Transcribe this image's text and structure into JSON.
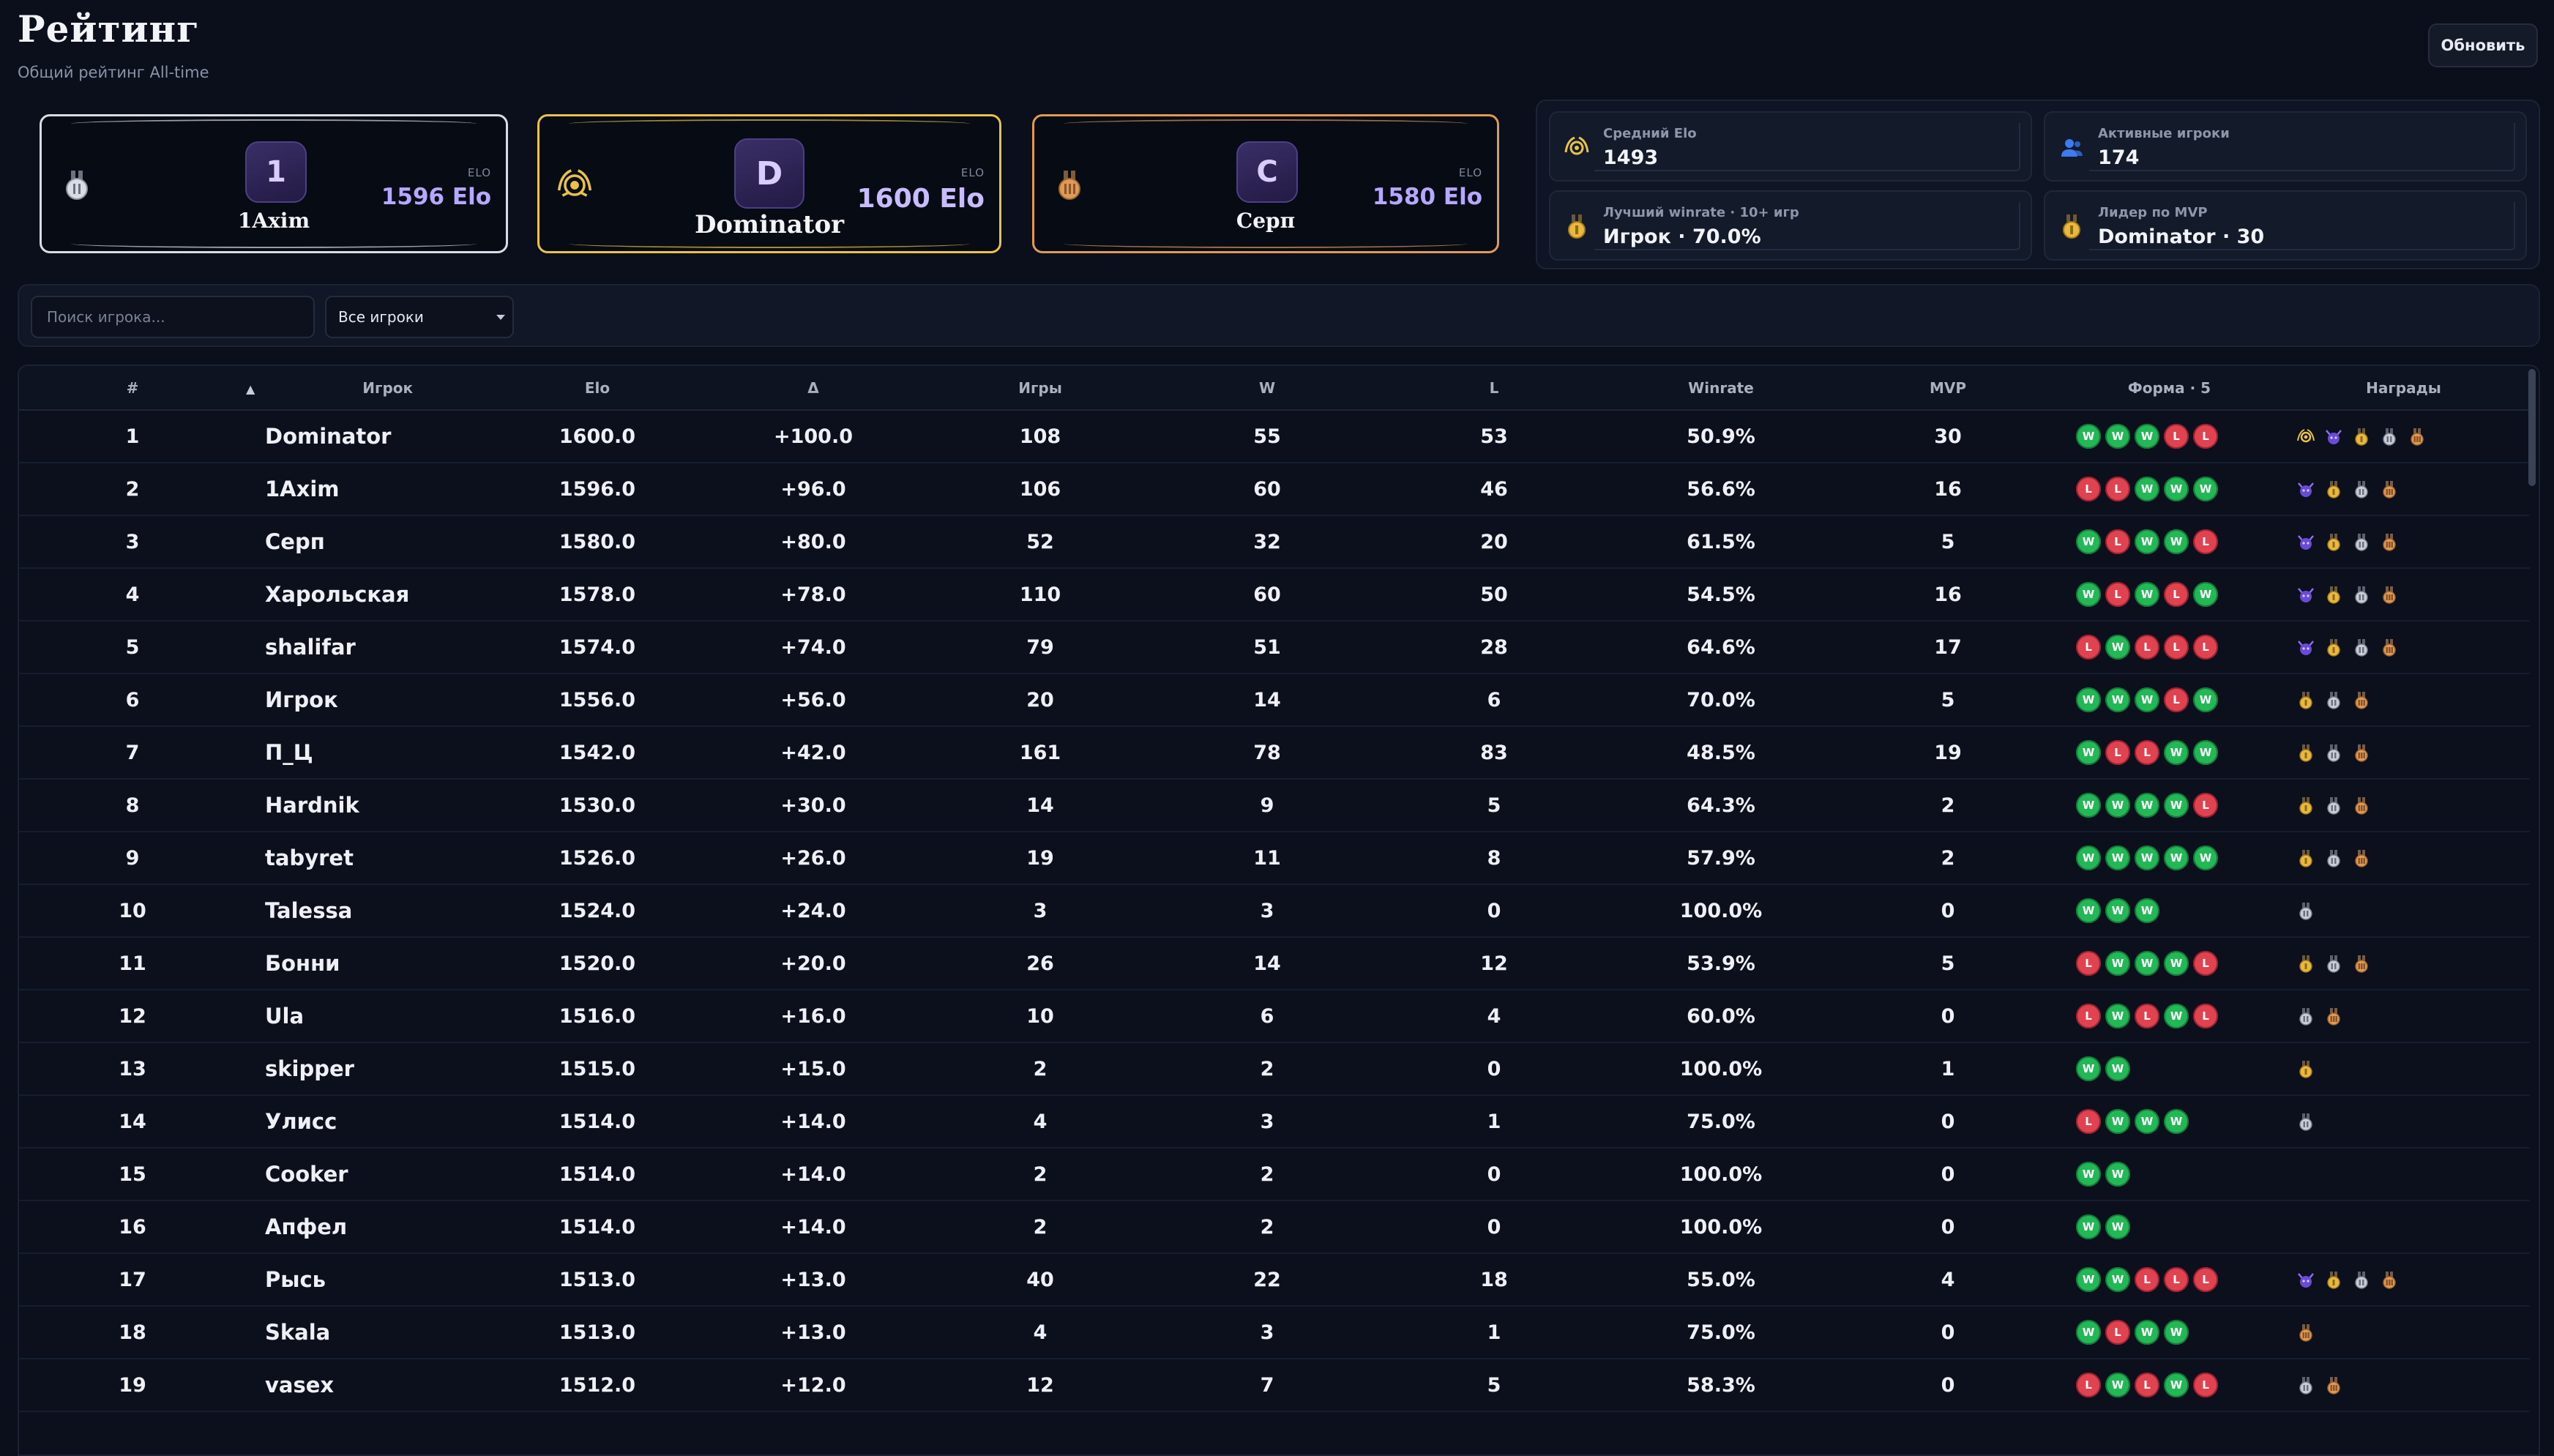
{
  "header": {
    "title": "Рейтинг",
    "subtitle": "Общий рейтинг All-time",
    "refresh_label": "Обновить"
  },
  "podium": [
    {
      "place": 2,
      "initial": "1",
      "name": "1Axim",
      "elo_label": "ELO",
      "elo": "1596 Elo",
      "color": "#d9dce3",
      "medal": "silver-medal-icon"
    },
    {
      "place": 1,
      "initial": "D",
      "name": "Dominator",
      "elo_label": "ELO",
      "elo": "1600 Elo",
      "color": "#e9c24a",
      "medal": "gold-laurel-icon"
    },
    {
      "place": 3,
      "initial": "С",
      "name": "Серп",
      "elo_label": "ELO",
      "elo": "1580 Elo",
      "color": "#e09a55",
      "medal": "bronze-medal-icon"
    }
  ],
  "stats": [
    {
      "label": "Средний Elo",
      "value": "1493",
      "icon": "laurel-icon"
    },
    {
      "label": "Активные игроки",
      "value": "174",
      "icon": "users-icon"
    },
    {
      "label": "Лучший winrate · 10+ игр",
      "value": "Игрок · 70.0%",
      "icon": "medal-icon"
    },
    {
      "label": "Лидер по MVP",
      "value": "Dominator · 30",
      "icon": "medal-icon"
    }
  ],
  "filters": {
    "search_placeholder": "Поиск игрока...",
    "players_select": "Все игроки"
  },
  "table": {
    "columns": [
      "#",
      "Игрок",
      "Elo",
      "Δ",
      "Игры",
      "W",
      "L",
      "Winrate",
      "MVP",
      "Форма · 5",
      "Награды"
    ],
    "rows": [
      {
        "rank": "1",
        "player": "Dominator",
        "elo": "1600.0",
        "delta": "+100.0",
        "games": "108",
        "w": "55",
        "l": "53",
        "winrate": "50.9%",
        "mvp": "30",
        "form": [
          "W",
          "W",
          "W",
          "L",
          "L"
        ],
        "awards": [
          "laurel",
          "demon",
          "gold",
          "silver",
          "bronze"
        ]
      },
      {
        "rank": "2",
        "player": "1Axim",
        "elo": "1596.0",
        "delta": "+96.0",
        "games": "106",
        "w": "60",
        "l": "46",
        "winrate": "56.6%",
        "mvp": "16",
        "form": [
          "L",
          "L",
          "W",
          "W",
          "W"
        ],
        "awards": [
          "demon",
          "gold",
          "silver",
          "bronze"
        ]
      },
      {
        "rank": "3",
        "player": "Серп",
        "elo": "1580.0",
        "delta": "+80.0",
        "games": "52",
        "w": "32",
        "l": "20",
        "winrate": "61.5%",
        "mvp": "5",
        "form": [
          "W",
          "L",
          "W",
          "W",
          "L"
        ],
        "awards": [
          "demon",
          "gold",
          "silver",
          "bronze"
        ]
      },
      {
        "rank": "4",
        "player": "Харольская",
        "elo": "1578.0",
        "delta": "+78.0",
        "games": "110",
        "w": "60",
        "l": "50",
        "winrate": "54.5%",
        "mvp": "16",
        "form": [
          "W",
          "L",
          "W",
          "L",
          "W"
        ],
        "awards": [
          "demon",
          "gold",
          "silver",
          "bronze"
        ]
      },
      {
        "rank": "5",
        "player": "shalifar",
        "elo": "1574.0",
        "delta": "+74.0",
        "games": "79",
        "w": "51",
        "l": "28",
        "winrate": "64.6%",
        "mvp": "17",
        "form": [
          "L",
          "W",
          "L",
          "L",
          "L"
        ],
        "awards": [
          "demon",
          "gold",
          "silver",
          "bronze"
        ]
      },
      {
        "rank": "6",
        "player": "Игрок",
        "elo": "1556.0",
        "delta": "+56.0",
        "games": "20",
        "w": "14",
        "l": "6",
        "winrate": "70.0%",
        "mvp": "5",
        "form": [
          "W",
          "W",
          "W",
          "L",
          "W"
        ],
        "awards": [
          "gold",
          "silver",
          "bronze"
        ]
      },
      {
        "rank": "7",
        "player": "П_Ц",
        "elo": "1542.0",
        "delta": "+42.0",
        "games": "161",
        "w": "78",
        "l": "83",
        "winrate": "48.5%",
        "mvp": "19",
        "form": [
          "W",
          "L",
          "L",
          "W",
          "W"
        ],
        "awards": [
          "gold",
          "silver",
          "bronze"
        ]
      },
      {
        "rank": "8",
        "player": "Hardnik",
        "elo": "1530.0",
        "delta": "+30.0",
        "games": "14",
        "w": "9",
        "l": "5",
        "winrate": "64.3%",
        "mvp": "2",
        "form": [
          "W",
          "W",
          "W",
          "W",
          "L"
        ],
        "awards": [
          "gold",
          "silver",
          "bronze"
        ]
      },
      {
        "rank": "9",
        "player": "tabyret",
        "elo": "1526.0",
        "delta": "+26.0",
        "games": "19",
        "w": "11",
        "l": "8",
        "winrate": "57.9%",
        "mvp": "2",
        "form": [
          "W",
          "W",
          "W",
          "W",
          "W"
        ],
        "awards": [
          "gold",
          "silver",
          "bronze"
        ]
      },
      {
        "rank": "10",
        "player": "Talessa",
        "elo": "1524.0",
        "delta": "+24.0",
        "games": "3",
        "w": "3",
        "l": "0",
        "winrate": "100.0%",
        "mvp": "0",
        "form": [
          "W",
          "W",
          "W"
        ],
        "awards": [
          "silver"
        ]
      },
      {
        "rank": "11",
        "player": "Бонни",
        "elo": "1520.0",
        "delta": "+20.0",
        "games": "26",
        "w": "14",
        "l": "12",
        "winrate": "53.9%",
        "mvp": "5",
        "form": [
          "L",
          "W",
          "W",
          "W",
          "L"
        ],
        "awards": [
          "gold",
          "silver",
          "bronze"
        ]
      },
      {
        "rank": "12",
        "player": "Ula",
        "elo": "1516.0",
        "delta": "+16.0",
        "games": "10",
        "w": "6",
        "l": "4",
        "winrate": "60.0%",
        "mvp": "0",
        "form": [
          "L",
          "W",
          "L",
          "W",
          "L"
        ],
        "awards": [
          "silver",
          "bronze"
        ]
      },
      {
        "rank": "13",
        "player": "skipper",
        "elo": "1515.0",
        "delta": "+15.0",
        "games": "2",
        "w": "2",
        "l": "0",
        "winrate": "100.0%",
        "mvp": "1",
        "form": [
          "W",
          "W"
        ],
        "awards": [
          "gold"
        ]
      },
      {
        "rank": "14",
        "player": "Улисс",
        "elo": "1514.0",
        "delta": "+14.0",
        "games": "4",
        "w": "3",
        "l": "1",
        "winrate": "75.0%",
        "mvp": "0",
        "form": [
          "L",
          "W",
          "W",
          "W"
        ],
        "awards": [
          "silver"
        ]
      },
      {
        "rank": "15",
        "player": "Cooker",
        "elo": "1514.0",
        "delta": "+14.0",
        "games": "2",
        "w": "2",
        "l": "0",
        "winrate": "100.0%",
        "mvp": "0",
        "form": [
          "W",
          "W"
        ],
        "awards": []
      },
      {
        "rank": "16",
        "player": "Апфел",
        "elo": "1514.0",
        "delta": "+14.0",
        "games": "2",
        "w": "2",
        "l": "0",
        "winrate": "100.0%",
        "mvp": "0",
        "form": [
          "W",
          "W"
        ],
        "awards": []
      },
      {
        "rank": "17",
        "player": "Рысь",
        "elo": "1513.0",
        "delta": "+13.0",
        "games": "40",
        "w": "22",
        "l": "18",
        "winrate": "55.0%",
        "mvp": "4",
        "form": [
          "W",
          "W",
          "L",
          "L",
          "L"
        ],
        "awards": [
          "demon",
          "gold",
          "silver",
          "bronze"
        ]
      },
      {
        "rank": "18",
        "player": "Skala",
        "elo": "1513.0",
        "delta": "+13.0",
        "games": "4",
        "w": "3",
        "l": "1",
        "winrate": "75.0%",
        "mvp": "0",
        "form": [
          "W",
          "L",
          "W",
          "W"
        ],
        "awards": [
          "bronze"
        ]
      },
      {
        "rank": "19",
        "player": "vasex",
        "elo": "1512.0",
        "delta": "+12.0",
        "games": "12",
        "w": "7",
        "l": "5",
        "winrate": "58.3%",
        "mvp": "0",
        "form": [
          "L",
          "W",
          "L",
          "W",
          "L"
        ],
        "awards": [
          "silver",
          "bronze"
        ]
      }
    ]
  },
  "colors": {
    "win": "#22b856",
    "loss": "#e0434f",
    "gold": "#e9c24a",
    "silver": "#d9dce3",
    "bronze": "#e09a55",
    "accent": "#b7a8ff"
  }
}
